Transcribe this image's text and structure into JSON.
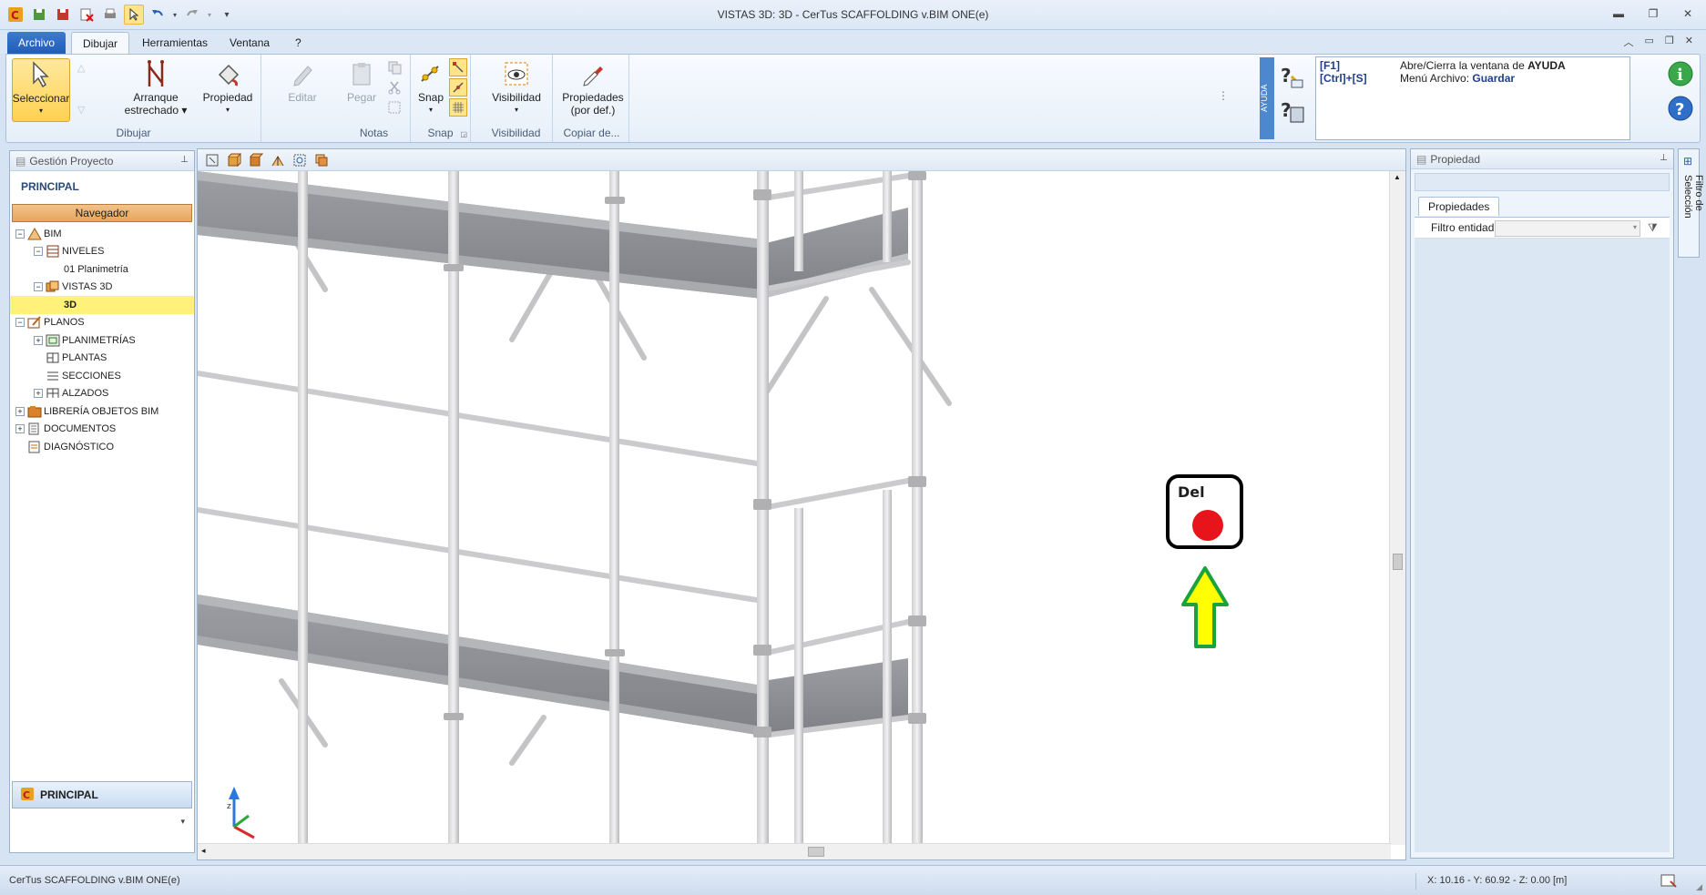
{
  "window": {
    "title": "VISTAS 3D: 3D - CerTus SCAFFOLDING v.BIM ONE(e)"
  },
  "tabs": [
    {
      "label": "Archivo"
    },
    {
      "label": "Dibujar"
    },
    {
      "label": "Herramientas"
    },
    {
      "label": "Ventana"
    },
    {
      "label": "?"
    }
  ],
  "ribbon": {
    "seleccionar": "Seleccionar",
    "arranque_l1": "Arranque",
    "arranque_l2": "estrechado",
    "propiedad": "Propiedad",
    "editar": "Editar",
    "pegar": "Pegar",
    "snap": "Snap",
    "visibilidad": "Visibilidad",
    "propiedades_l1": "Propiedades",
    "propiedades_l2": "(por def.)",
    "groups": {
      "dibujar": "Dibujar",
      "notas": "Notas",
      "snap": "Snap",
      "visibilidad": "Visibilidad",
      "copiar": "Copiar de..."
    },
    "ayuda_strip": "AYUDA"
  },
  "help": {
    "line1_key": "[F1]",
    "line1_text": "Abre/Cierra la ventana de ",
    "line1_bold": "AYUDA",
    "line2_key": "[Ctrl]+[S]",
    "line2_text": "Menú Archivo: ",
    "line2_bold": "Guardar"
  },
  "left_panel": {
    "header": "Gestión Proyecto",
    "title": "PRINCIPAL",
    "navigator": "Navegador",
    "tree": {
      "bim": "BIM",
      "niveles": "NIVELES",
      "planimetria": "01 Planimetría",
      "vistas3d": "VISTAS 3D",
      "v3d": "3D",
      "planos": "PLANOS",
      "planimetrias": "PLANIMETRÍAS",
      "plantas": "PLANTAS",
      "secciones": "SECCIONES",
      "alzados": "ALZADOS",
      "libreria": "LIBRERÍA OBJETOS BIM",
      "documentos": "DOCUMENTOS",
      "diagnostico": "DIAGNÓSTICO"
    },
    "bottom": "PRINCIPAL"
  },
  "right_panel": {
    "header": "Propiedad",
    "tab": "Propiedades",
    "filter_label": "Filtro entidad",
    "side_tab": "Filtro de Selección"
  },
  "overlay": {
    "key_label": "Del"
  },
  "status": {
    "left": "CerTus SCAFFOLDING v.BIM ONE(e)",
    "coords": "X: 10.16 - Y: 60.92 - Z: 0.00 [m]"
  },
  "colors": {
    "accent": "#1f5db8",
    "selection": "#fff17a",
    "navigator": "#e8a55c",
    "delete_dot": "#e8141b",
    "arrow_fill": "#ffff00",
    "arrow_stroke": "#1aa33a"
  }
}
